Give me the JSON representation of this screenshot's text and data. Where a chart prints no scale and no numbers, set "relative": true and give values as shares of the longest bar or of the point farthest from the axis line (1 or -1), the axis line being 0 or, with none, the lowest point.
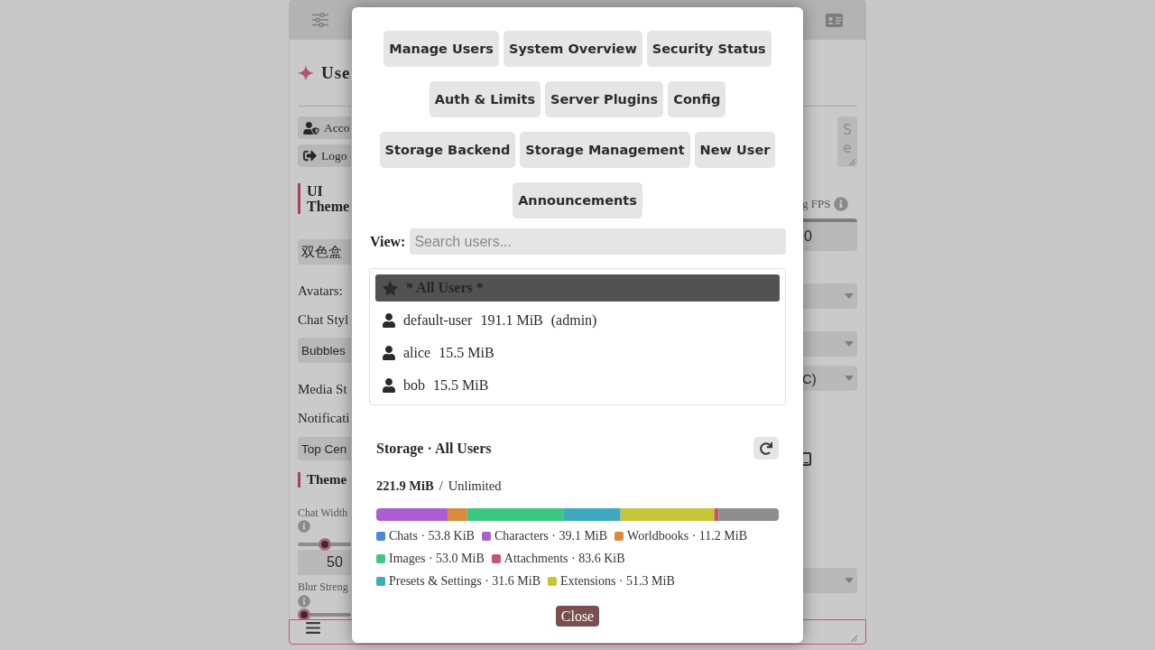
{
  "settings_panel": {
    "title": "Use",
    "account_button": "Acco",
    "logout_button": "Logo",
    "ui_theme_heading": "UI Theme",
    "theme_select": "双色盒",
    "avatars_label": "Avatars:",
    "chat_style_label": "Chat Styl",
    "chat_style_select": "Bubbles",
    "media_label": "Media St",
    "notifications_label": "Notificati",
    "notifications_select": "Top Cen",
    "theme_heading": "Theme",
    "chat_width": {
      "label": "Chat Width",
      "level": 0.5,
      "value": "50"
    },
    "blur_strength": {
      "label": "Blur Streng",
      "level": 0
    },
    "textarea": {
      "placeholder": "Se"
    },
    "fps": {
      "label": "g FPS",
      "value": "0"
    },
    "select_value": "C)"
  },
  "dialog": {
    "nav_buttons": [
      "Manage Users",
      "System Overview",
      "Security Status",
      "Auth & Limits",
      "Server Plugins",
      "Config",
      "Storage Backend",
      "Storage Management",
      "New User",
      "Announcements"
    ],
    "view_label": "View:",
    "search": {
      "placeholder": "Search users..."
    },
    "users": [
      {
        "kind": "all",
        "name": "* All Users *",
        "selected": true
      },
      {
        "kind": "user",
        "name": "default-user",
        "size": "191.1 MiB",
        "role": "(admin)",
        "selected": false
      },
      {
        "kind": "user",
        "name": "alice",
        "size": "15.5 MiB",
        "selected": false
      },
      {
        "kind": "user",
        "name": "bob",
        "size": "15.5 MiB",
        "selected": false
      }
    ],
    "storage": {
      "title": "Storage · All Users",
      "used": "221.9 MiB",
      "separator": "/",
      "quota": "Unlimited",
      "chart_data": {
        "type": "bar",
        "orientation": "horizontal",
        "stacked": true,
        "relative": true,
        "series": [
          {
            "color": "#aa5fd0",
            "values": [
              0.177
            ]
          },
          {
            "color": "#d98b3e",
            "values": [
              0.049
            ]
          },
          {
            "color": "#3ac780",
            "values": [
              0.24
            ]
          },
          {
            "color": "#3ea9be",
            "values": [
              0.141
            ]
          },
          {
            "color": "#c5c638",
            "values": [
              0.233
            ]
          },
          {
            "color": "#c9525f",
            "values": [
              0.011
            ]
          },
          {
            "color": "#8e8e8e",
            "values": [
              0.149
            ]
          }
        ]
      },
      "legend": [
        {
          "label": "Chats · 53.8 KiB",
          "color": "#4a8ad4"
        },
        {
          "label": "Characters · 39.1 MiB",
          "color": "#a862d0"
        },
        {
          "label": "Worldbooks · 11.2 MiB",
          "color": "#d98a3f"
        },
        {
          "label": "Images · 53.0 MiB",
          "color": "#3cc880"
        },
        {
          "label": "Attachments · 83.6 KiB",
          "color": "#c8547a"
        },
        {
          "label": "Presets & Settings · 31.6 MiB",
          "color": "#3fa9bd"
        },
        {
          "label": "Extensions · 51.3 MiB",
          "color": "#c6c63a"
        }
      ]
    },
    "close_button": "Close"
  }
}
